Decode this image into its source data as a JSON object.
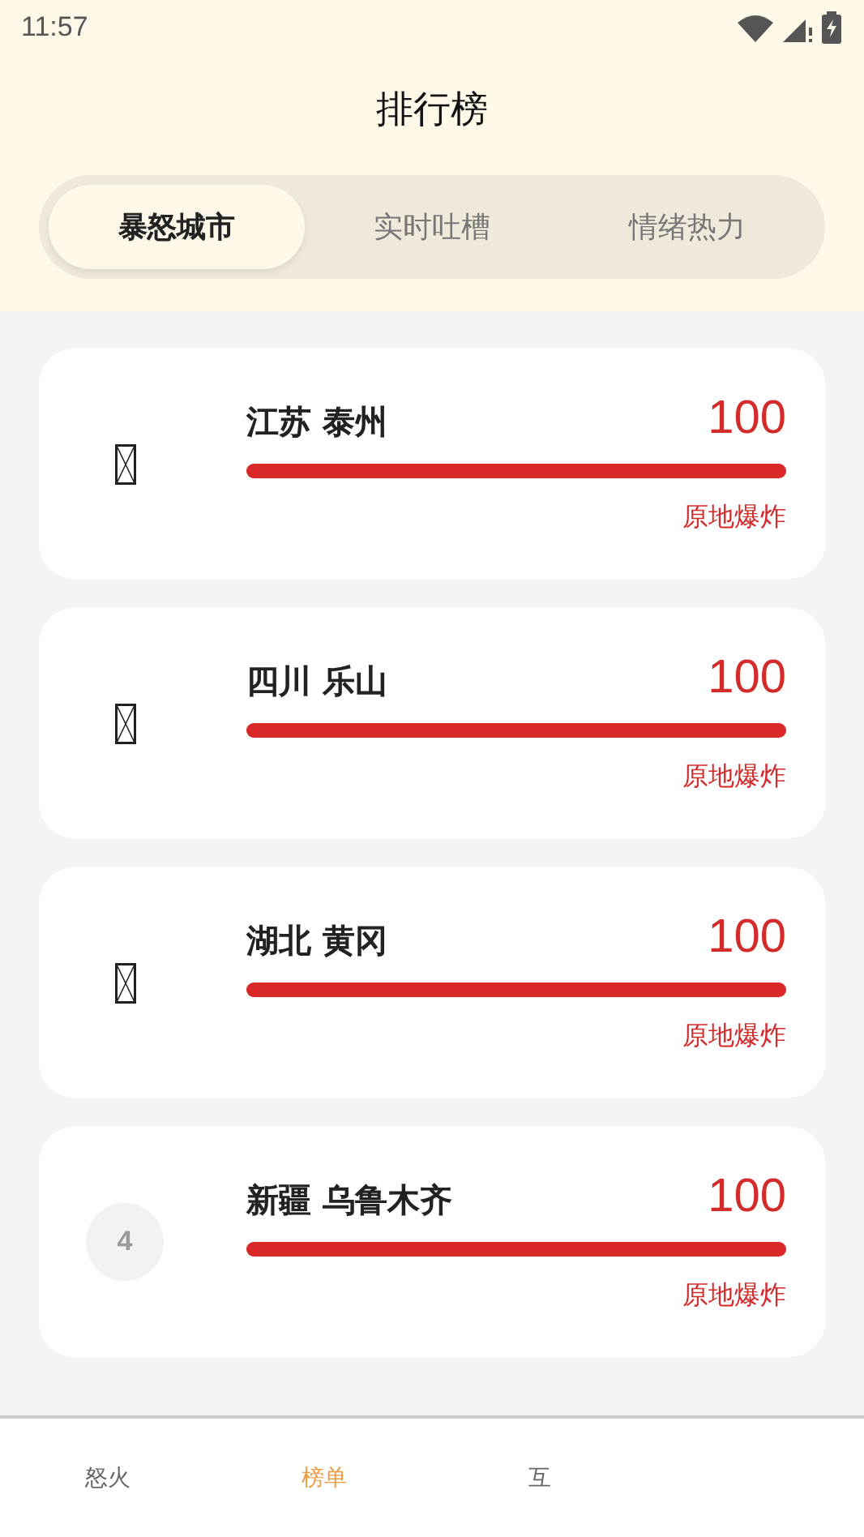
{
  "status_bar": {
    "time": "11:57"
  },
  "header": {
    "title": "排行榜"
  },
  "tabs": [
    {
      "label": "暴怒城市",
      "selected": true
    },
    {
      "label": "实时吐槽",
      "selected": false
    },
    {
      "label": "情绪热力",
      "selected": false
    }
  ],
  "rankings": [
    {
      "kind": "icon",
      "city": "江苏 泰州",
      "score": "100",
      "level": 1,
      "status": "原地爆炸"
    },
    {
      "kind": "icon",
      "city": "四川 乐山",
      "score": "100",
      "level": 1,
      "status": "原地爆炸"
    },
    {
      "kind": "icon",
      "city": "湖北 黄冈",
      "score": "100",
      "level": 1,
      "status": "原地爆炸"
    },
    {
      "kind": "number",
      "rank": "4",
      "city": "新疆 乌鲁木齐",
      "score": "100",
      "level": 1,
      "status": "原地爆炸"
    }
  ],
  "bottom_nav": [
    {
      "label": "怒火",
      "selected": false
    },
    {
      "label": "榜单",
      "selected": true
    },
    {
      "label": "互",
      "selected": false
    }
  ]
}
